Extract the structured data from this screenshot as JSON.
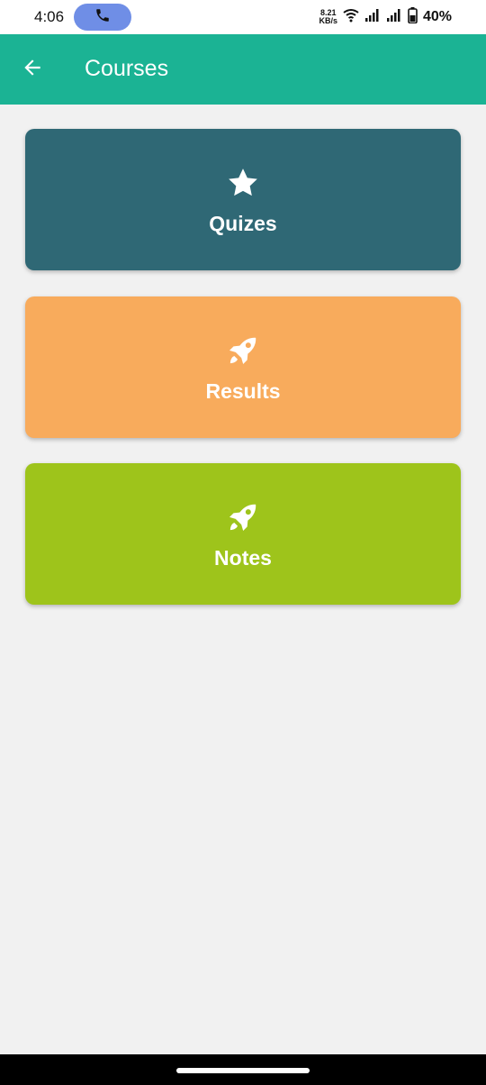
{
  "status_bar": {
    "time": "4:06",
    "net_speed_value": "8.21",
    "net_speed_unit": "KB/s",
    "battery": "40%",
    "call_icon": "phone-icon",
    "call_pill_color": "#6f8ee6"
  },
  "app_bar": {
    "title": "Courses",
    "back_icon": "arrow-left-icon",
    "color": "#1bb394"
  },
  "cards": [
    {
      "label": "Quizes",
      "icon": "star-icon",
      "color": "#2f6875"
    },
    {
      "label": "Results",
      "icon": "rocket-icon",
      "color": "#f8ab5c"
    },
    {
      "label": "Notes",
      "icon": "rocket-icon",
      "color": "#9ec41b"
    }
  ]
}
